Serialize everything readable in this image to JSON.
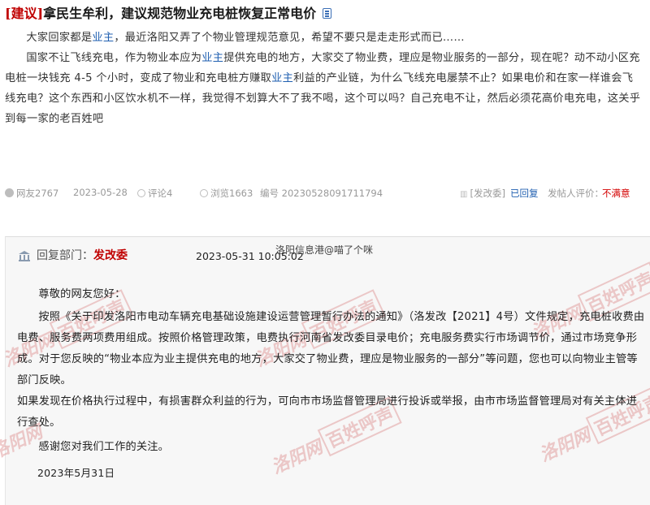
{
  "post": {
    "tag": "[建议]",
    "title": "拿民生牟利，建议规范物业充电桩恢复正常电价",
    "paragraph1": [
      {
        "t": "大家回家都是"
      },
      {
        "t": "业主",
        "k": true
      },
      {
        "t": "，最近洛阳又弄了个物业管理规范意见，希望不要只是走走形式而已……"
      }
    ],
    "paragraph2": [
      {
        "t": "国家不让飞线充电，作为物业本应为"
      },
      {
        "t": "业主",
        "k": true
      },
      {
        "t": "提供充电的地方，大家交了物业费，理应是物业服务的一部分，现在呢？动不动小区充电桩一块钱充 4-5 个小时，变成了物业和充电桩方赚取"
      },
      {
        "t": "业主",
        "k": true
      },
      {
        "t": "利益的产业链，为什么飞线充电屡禁不止？如果电价和在家一样谁会飞线充电？这个东西和小区饮水机不一样，我觉得不划算大不了我不喝，这个可以吗？自己充电不让，然后必须花高价电充电，这关乎到每一家的老百姓吧"
      }
    ]
  },
  "meta": {
    "author": "网友2767",
    "date": "2023-05-28",
    "comments": "评论4",
    "views": "浏览1663",
    "serial": "编号 20230528091711794",
    "dept_tag": "[发改委]",
    "status": "已回复",
    "rating_label": "发帖人评价：",
    "rating": "不满意"
  },
  "reply": {
    "dept_label": "回复部门：",
    "dept_name": "发改委",
    "time": "2023-05-31 10:05:02",
    "watermark_text": "洛阳信息港@喵了个咪",
    "greeting": "尊敬的网友您好：",
    "body1": "按照《关于印发洛阳市电动车辆充电基础设施建设运营管理暂行办法的通知》（洛发改【2021】4号）文件规定，充电桩收费由电费、服务费两项费用组成。按照价格管理政策，电费执行河南省发改委目录电价；充电服务费实行市场调节价，通过市场竞争形成。对于您反映的“物业本应为业主提供充电的地方，大家交了物业费，理应是物业服务的一部分”等问题，您也可以向物业主管等部门反映。",
    "body2": "如果发现在价格执行过程中，有损害群众利益的行为，可向市市场监督管理局进行投诉或举报，由市市场监督管理局对有关主体进行查处。",
    "thanks": "感谢您对我们工作的关注。",
    "date": "2023年5月31日"
  },
  "stamp": {
    "script_text": "洛阳网",
    "box_text": "百姓呼声"
  },
  "colors": {
    "title_tag": "#c00000",
    "keyword": "#1f5fb0",
    "link": "#1f5fb0",
    "unsatisfied": "#d40000",
    "reply_bg": "#f7f7f7"
  }
}
